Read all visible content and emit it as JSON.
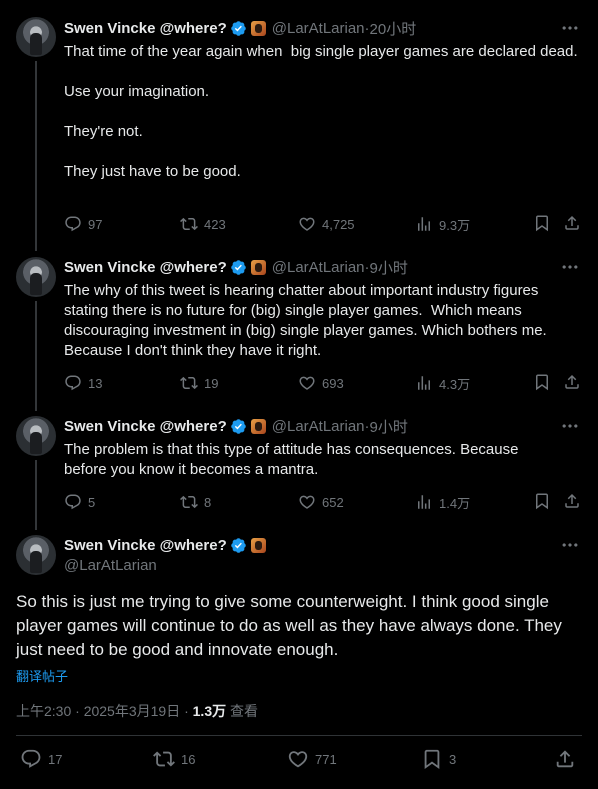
{
  "tweets": [
    {
      "name": "Swen Vincke @where?",
      "handle": "@LarAtLarian",
      "time": "20小时",
      "text": "That time of the year again when  big single player games are declared dead.\n\nUse your imagination.\n\nThey're not.\n\nThey just have to be good.",
      "replies": "97",
      "reposts": "423",
      "likes": "4,725",
      "views": "9.3万"
    },
    {
      "name": "Swen Vincke @where?",
      "handle": "@LarAtLarian",
      "time": "9小时",
      "text": "The why of this tweet is hearing chatter about important industry figures stating there is no future for (big) single player games.  Which means discouraging investment in (big) single player games. Which bothers me. Because I don't think they have it right.",
      "replies": "13",
      "reposts": "19",
      "likes": "693",
      "views": "4.3万"
    },
    {
      "name": "Swen Vincke @where?",
      "handle": "@LarAtLarian",
      "time": "9小时",
      "text": "The problem is that this type of attitude has consequences. Because before you know it becomes a mantra.",
      "replies": "5",
      "reposts": "8",
      "likes": "652",
      "views": "1.4万"
    }
  ],
  "main": {
    "name": "Swen Vincke @where?",
    "handle": "@LarAtLarian",
    "text": "So this is just me trying to give some counterweight. I think good single player games will continue to do as well as they have always done. They just need to be good and innovate enough.",
    "translate": "翻译帖子",
    "datetime": "上午2:30 · 2025年3月19日 · ",
    "views_count": "1.3万",
    "views_label": " 查看",
    "replies": "17",
    "reposts": "16",
    "likes": "771",
    "bookmarks": "3"
  },
  "separator": " · ",
  "colors": {
    "background": "#000000",
    "text": "#e7e9ea",
    "muted": "#71767b",
    "link": "#1d9bf0",
    "verified": "#1d9bf0"
  }
}
